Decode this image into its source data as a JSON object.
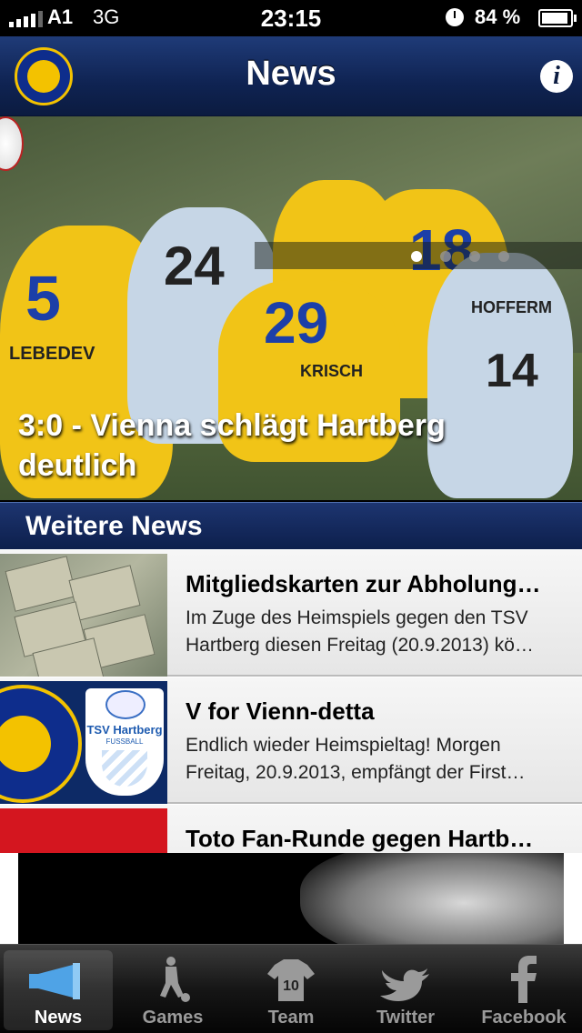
{
  "status_bar": {
    "carrier": "A1",
    "network": "3G",
    "time": "23:15",
    "battery": "84 %"
  },
  "nav": {
    "title": "News",
    "info_label": "i",
    "logo_text": "VIENNA FOOTBALL CLUB 1894"
  },
  "hero": {
    "headline": "3:0 - Vienna schlägt Hartberg deutlich",
    "jerseys": [
      "5",
      "LEBEDEV",
      "24",
      "29",
      "KRISCH",
      "18",
      "14",
      "HOFFERM"
    ],
    "page_count": 4,
    "active_page": 1
  },
  "section": {
    "title": "Weitere News"
  },
  "news": [
    {
      "title": "Mitgliedskarten zur Abholung…",
      "desc": "Im Zuge des Heimspiels gegen den TSV Hartberg diesen Freitag (20.9.2013) kö…",
      "thumb": "membership-cards"
    },
    {
      "title": "V for Vienn-detta",
      "desc": "Endlich wieder Heimspieltag! Morgen Freitag, 20.9.2013, empfängt der First…",
      "thumb": "club-logos",
      "thumb_text": "TSV Hartberg",
      "thumb_sub": "FUSSBALL"
    },
    {
      "title": "Toto Fan-Runde gegen Hartb…",
      "desc": "",
      "thumb": "toto"
    }
  ],
  "tabs": [
    {
      "label": "News",
      "icon": "megaphone-icon",
      "active": true
    },
    {
      "label": "Games",
      "icon": "soccer-player-icon",
      "active": false
    },
    {
      "label": "Team",
      "icon": "jersey-icon",
      "active": false,
      "icon_text": "10"
    },
    {
      "label": "Twitter",
      "icon": "twitter-bird-icon",
      "active": false
    },
    {
      "label": "Facebook",
      "icon": "facebook-icon",
      "active": false
    }
  ],
  "colors": {
    "nav_blue": "#0f2352",
    "club_yellow": "#f3c200",
    "club_blue": "#0e2d8c"
  }
}
